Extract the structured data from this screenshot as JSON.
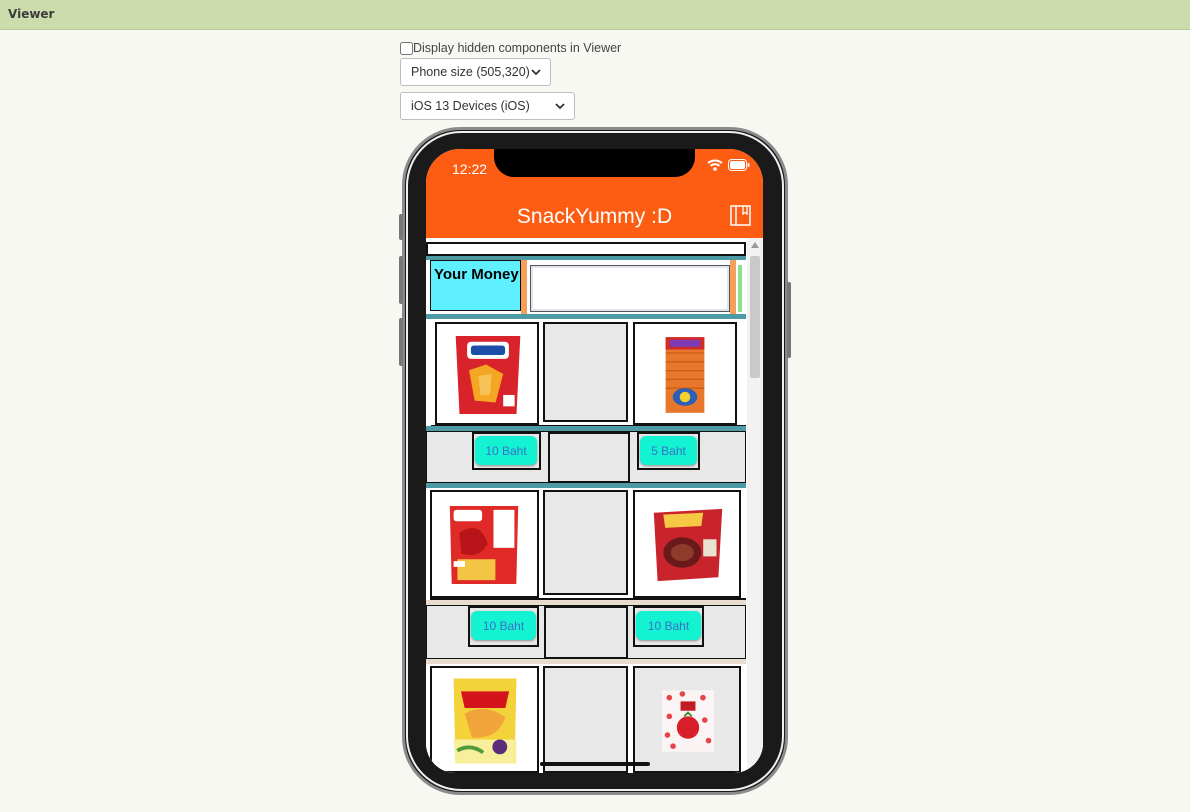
{
  "panel": {
    "title": "Viewer"
  },
  "controls": {
    "hidden_components_label": "Display hidden components in Viewer",
    "phone_size": "Phone size (505,320)",
    "device_theme": "iOS 13 Devices (iOS)"
  },
  "phone": {
    "status_time": "12:22",
    "app_title": "SnackYummy :D",
    "money_label": "Your Money",
    "money_value": "",
    "products": [
      {
        "name": "snack-1",
        "price": "10 Baht"
      },
      {
        "name": "snack-2",
        "price": "5 Baht"
      },
      {
        "name": "snack-3",
        "price": "10 Baht"
      },
      {
        "name": "snack-4",
        "price": "10 Baht"
      },
      {
        "name": "snack-5",
        "price": ""
      },
      {
        "name": "snack-6",
        "price": ""
      }
    ]
  },
  "colors": {
    "header_bar": "#cddcad",
    "app_bar": "#fd5d13",
    "money_label_bg": "#5ff0ff",
    "price_button": "#13f2d1",
    "price_text": "#3b72c7"
  },
  "icons": {
    "wifi": "wifi-icon",
    "battery": "battery-icon",
    "book": "book-icon",
    "dropdown": "chevron-down-icon"
  }
}
